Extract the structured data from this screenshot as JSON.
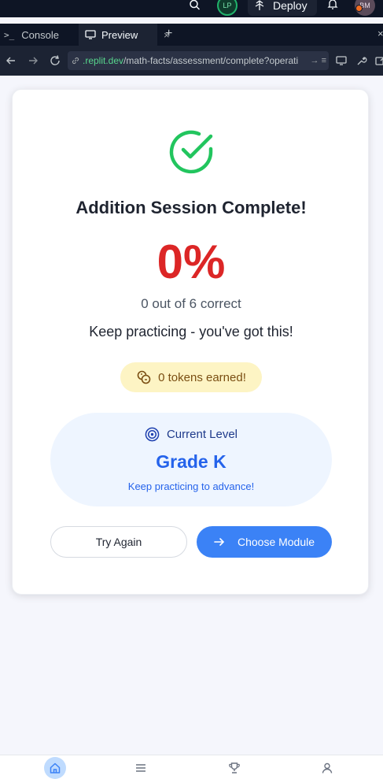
{
  "topbar": {
    "user_initials": "LP",
    "deploy_label": "Deploy",
    "avatar_initials": "BM"
  },
  "tabs": {
    "console_label": "Console",
    "preview_label": "Preview",
    "close_symbol": "×",
    "add_symbol": "+"
  },
  "address": {
    "host": ".replit.dev",
    "path": "/math-facts/assessment/complete?operati",
    "tail": "→ ≡"
  },
  "result": {
    "title": "Addition Session Complete!",
    "score": "0%",
    "correct_text": "0 out of 6 correct",
    "encouragement": "Keep practicing - you've got this!",
    "tokens_text": "0 tokens earned!"
  },
  "level": {
    "heading": "Current Level",
    "grade": "Grade K",
    "note": "Keep practicing to advance!"
  },
  "actions": {
    "try_again": "Try Again",
    "choose_module": "Choose Module"
  },
  "bottom_nav": {
    "items": [
      "home-icon",
      "menu-icon",
      "trophy-icon",
      "profile-icon"
    ],
    "active": "home-icon"
  },
  "colors": {
    "success": "#22c55e",
    "score_red": "#dc2626",
    "primary_blue": "#3b82f6",
    "token_bg": "#fdf4c4",
    "level_bg": "#eef5ff"
  }
}
